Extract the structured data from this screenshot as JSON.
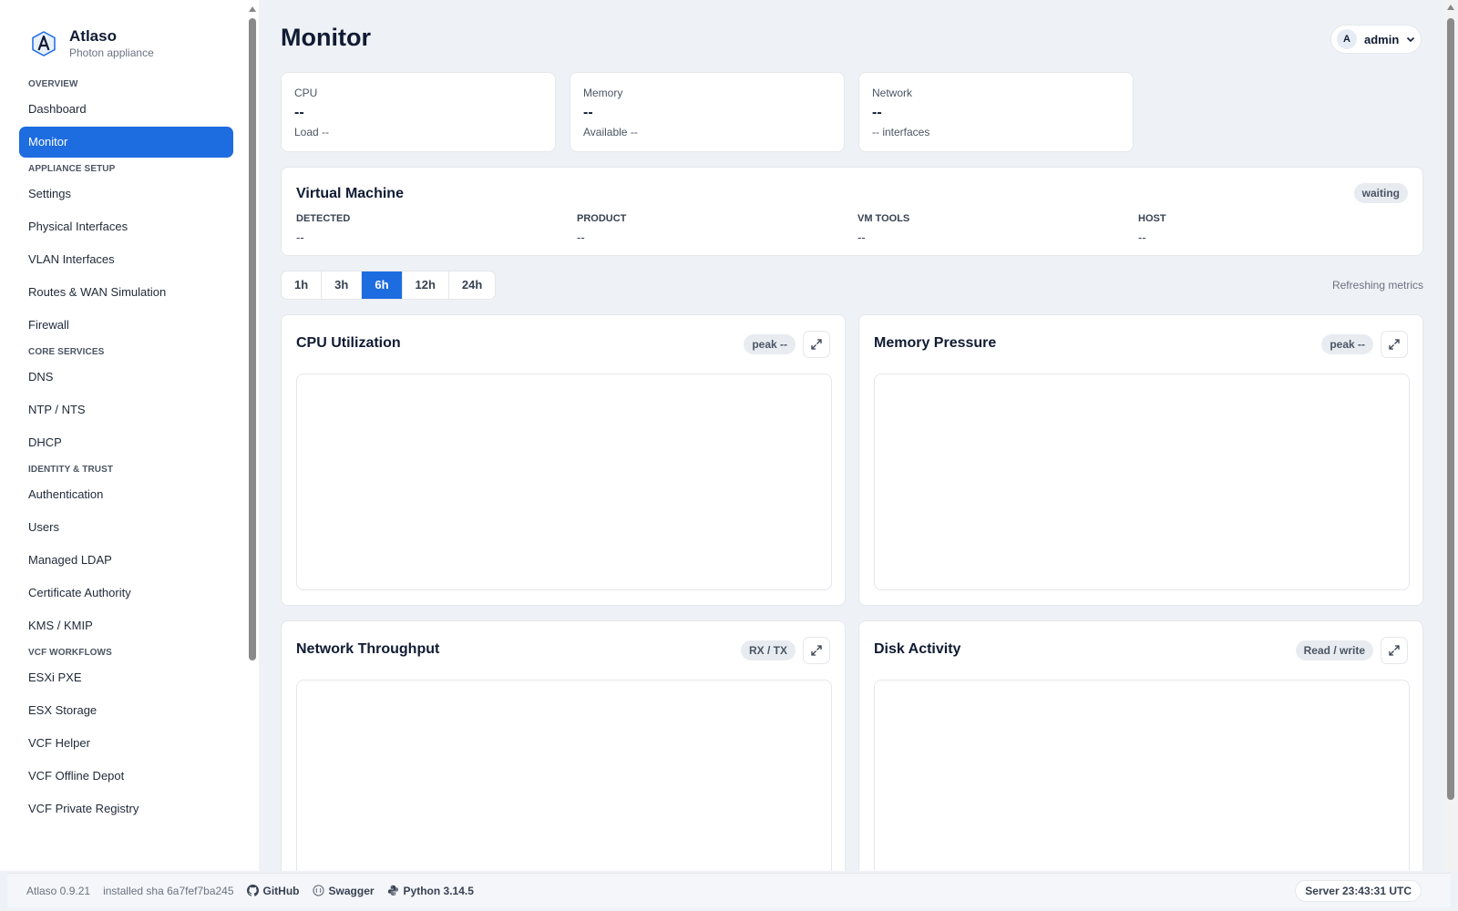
{
  "brand": {
    "name": "Atlaso",
    "subtitle": "Photon appliance"
  },
  "sidebar": {
    "sections": [
      {
        "title": "OVERVIEW",
        "items": [
          {
            "label": "Dashboard",
            "active": false
          },
          {
            "label": "Monitor",
            "active": true
          }
        ]
      },
      {
        "title": "APPLIANCE SETUP",
        "items": [
          {
            "label": "Settings"
          },
          {
            "label": "Physical Interfaces"
          },
          {
            "label": "VLAN Interfaces"
          },
          {
            "label": "Routes & WAN Simulation"
          },
          {
            "label": "Firewall"
          }
        ]
      },
      {
        "title": "CORE SERVICES",
        "items": [
          {
            "label": "DNS"
          },
          {
            "label": "NTP / NTS"
          },
          {
            "label": "DHCP"
          }
        ]
      },
      {
        "title": "IDENTITY & TRUST",
        "items": [
          {
            "label": "Authentication"
          },
          {
            "label": "Users"
          },
          {
            "label": "Managed LDAP"
          },
          {
            "label": "Certificate Authority"
          },
          {
            "label": "KMS / KMIP"
          }
        ]
      },
      {
        "title": "VCF WORKFLOWS",
        "items": [
          {
            "label": "ESXi PXE"
          },
          {
            "label": "ESX Storage"
          },
          {
            "label": "VCF Helper"
          },
          {
            "label": "VCF Offline Depot"
          },
          {
            "label": "VCF Private Registry"
          }
        ]
      }
    ]
  },
  "header": {
    "title": "Monitor",
    "user": {
      "initial": "A",
      "name": "admin"
    }
  },
  "stats": {
    "cpu": {
      "label": "CPU",
      "value": "--",
      "sub": "Load --"
    },
    "memory": {
      "label": "Memory",
      "value": "--",
      "sub": "Available --"
    },
    "network": {
      "label": "Network",
      "value": "--",
      "sub": "-- interfaces"
    }
  },
  "vm": {
    "title": "Virtual Machine",
    "status": "waiting",
    "fields": [
      {
        "label": "DETECTED",
        "value": "--"
      },
      {
        "label": "PRODUCT",
        "value": "--"
      },
      {
        "label": "VM TOOLS",
        "value": "--"
      },
      {
        "label": "HOST",
        "value": "--"
      }
    ]
  },
  "time_ranges": [
    {
      "label": "1h"
    },
    {
      "label": "3h"
    },
    {
      "label": "6h",
      "active": true
    },
    {
      "label": "12h"
    },
    {
      "label": "24h"
    }
  ],
  "refresh_status": "Refreshing metrics",
  "charts": {
    "cpu": {
      "title": "CPU Utilization",
      "badge": "peak --"
    },
    "memory": {
      "title": "Memory Pressure",
      "badge": "peak --"
    },
    "network": {
      "title": "Network Throughput",
      "badge": "RX / TX"
    },
    "disk": {
      "title": "Disk Activity",
      "badge": "Read / write"
    }
  },
  "footer": {
    "version": "Atlaso 0.9.21",
    "sha": "installed sha 6a7fef7ba245",
    "links": {
      "github": "GitHub",
      "swagger": "Swagger",
      "python": "Python 3.14.5"
    },
    "server_time": "Server 23:43:31 UTC"
  },
  "colors": {
    "accent": "#1d6ce0",
    "background": "#eef1f5",
    "text": "#101b33"
  }
}
